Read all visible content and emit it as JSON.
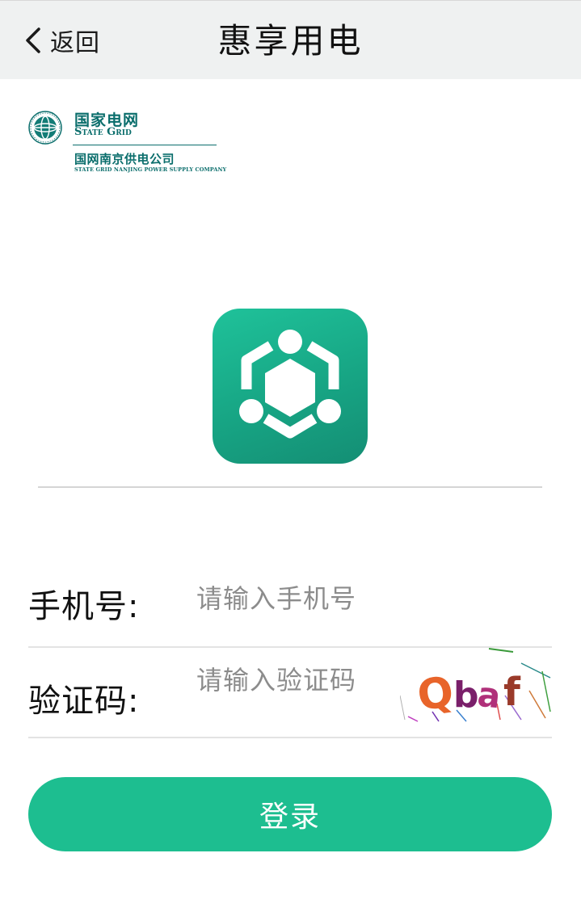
{
  "header": {
    "back_label": "返回",
    "title": "惠享用电"
  },
  "brand": {
    "name_cn": "国家电网",
    "name_en": "State Grid",
    "company_cn": "国网南京供电公司",
    "company_en": "STATE GRID NANJING POWER SUPPLY COMPANY"
  },
  "form": {
    "phone_label": "手机号:",
    "phone_placeholder": "请输入手机号",
    "code_label": "验证码:",
    "code_placeholder": "请输入验证码",
    "captcha_text": "Qbaf"
  },
  "login_label": "登录",
  "colors": {
    "accent": "#1dbe90",
    "header_bg": "#eff1f1",
    "brand": "#0b6e6c"
  }
}
